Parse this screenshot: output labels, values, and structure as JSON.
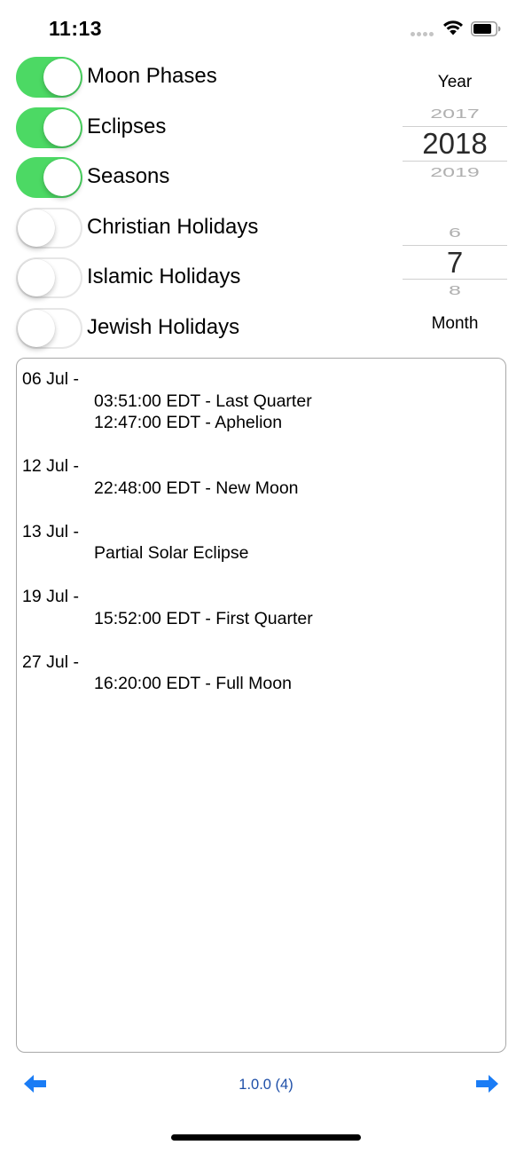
{
  "status_bar": {
    "time": "11:13",
    "icons": [
      "signal-dots-icon",
      "wifi-icon",
      "battery-icon"
    ]
  },
  "toggles": [
    {
      "label": "Moon Phases",
      "on": true
    },
    {
      "label": "Eclipses",
      "on": true
    },
    {
      "label": "Seasons",
      "on": true
    },
    {
      "label": "Christian Holidays",
      "on": false
    },
    {
      "label": "Islamic Holidays",
      "on": false
    },
    {
      "label": "Jewish Holidays",
      "on": false
    }
  ],
  "year_picker": {
    "label": "Year",
    "prev": "2017",
    "selected": "2018",
    "next": "2019"
  },
  "month_picker": {
    "label": "Month",
    "prev": "6",
    "selected": "7",
    "next": "8"
  },
  "events": [
    {
      "date": "06 Jul -",
      "items": [
        "03:51:00 EDT - Last Quarter",
        "12:47:00 EDT - Aphelion"
      ]
    },
    {
      "date": "12 Jul -",
      "items": [
        "22:48:00 EDT - New Moon"
      ]
    },
    {
      "date": "13 Jul -",
      "items": [
        "Partial Solar Eclipse"
      ]
    },
    {
      "date": "19 Jul -",
      "items": [
        "15:52:00 EDT - First Quarter"
      ]
    },
    {
      "date": "27 Jul -",
      "items": [
        "16:20:00 EDT - Full Moon"
      ]
    }
  ],
  "footer": {
    "version": "1.0.0 (4)",
    "prev_icon": "arrow-left-icon",
    "next_icon": "arrow-right-icon"
  },
  "colors": {
    "switch_on": "#4cd964",
    "accent_blue": "#1a7cf5",
    "version_text": "#1e4fa8"
  }
}
